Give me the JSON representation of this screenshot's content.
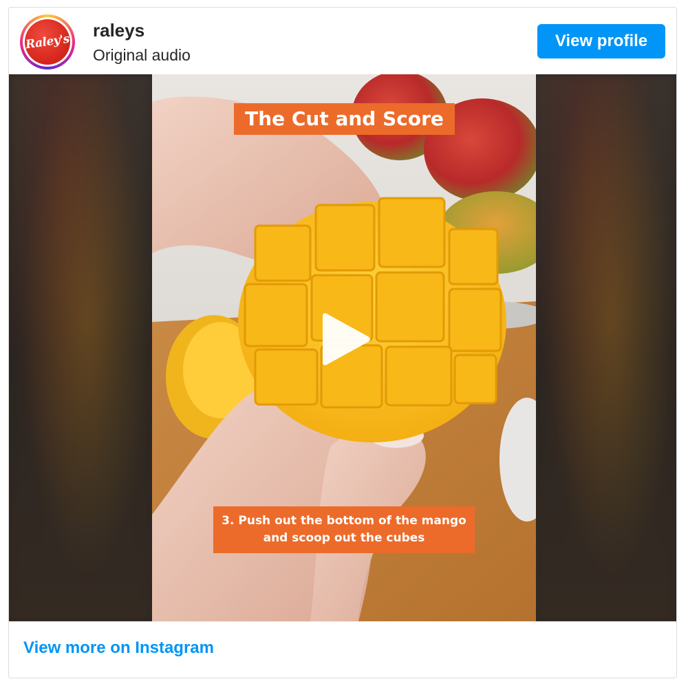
{
  "header": {
    "avatar_text": "Raley's",
    "username": "raleys",
    "subtitle": "Original audio",
    "view_profile_label": "View profile"
  },
  "media": {
    "title_overlay": "The Cut and Score",
    "caption_overlay": "3. Push out the bottom of the mango\nand scoop out the cubes",
    "play_icon": "play-icon"
  },
  "footer": {
    "link_label": "View more on Instagram"
  },
  "colors": {
    "accent_blue": "#0095f6",
    "overlay_orange": "#ec6b2a",
    "brand_red": "#d4251b"
  }
}
